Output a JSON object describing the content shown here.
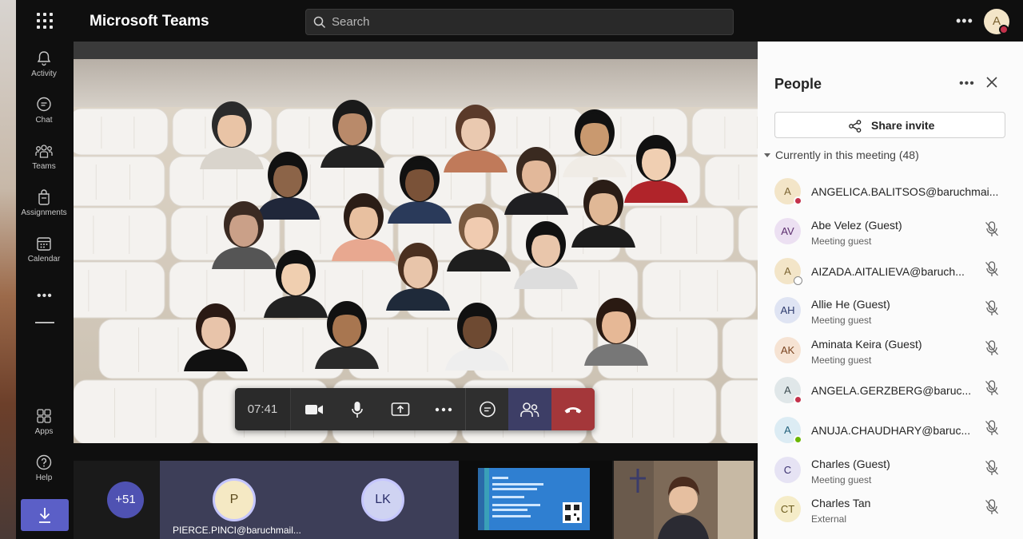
{
  "app": {
    "title": "Microsoft Teams"
  },
  "search": {
    "placeholder": "Search"
  },
  "user": {
    "initial": "A"
  },
  "rail": {
    "items": [
      {
        "label": "Activity",
        "icon": "bell-icon"
      },
      {
        "label": "Chat",
        "icon": "chat-icon"
      },
      {
        "label": "Teams",
        "icon": "teams-icon"
      },
      {
        "label": "Assignments",
        "icon": "assignments-icon"
      },
      {
        "label": "Calendar",
        "icon": "calendar-icon"
      },
      {
        "label": "Apps",
        "icon": "apps-icon"
      },
      {
        "label": "Help",
        "icon": "help-icon"
      }
    ]
  },
  "controls": {
    "timer": "07:41"
  },
  "strip": {
    "more_count": "+51",
    "tile_initials": [
      "P",
      "LK"
    ],
    "tile_name": "PIERCE.PINCI@baruchmail..."
  },
  "panel": {
    "title": "People",
    "share_invite": "Share invite",
    "section_label": "Currently in this meeting",
    "section_count": "(48)",
    "participants": [
      {
        "initials": "A",
        "name": "ANGELICA.BALITSOS@baruchmai...",
        "subtitle": "",
        "status": "busy",
        "avatar_bg": "#f3e5c8",
        "avatar_fg": "#7a6230"
      },
      {
        "initials": "AV",
        "name": "Abe Velez (Guest)",
        "subtitle": "Meeting guest",
        "status": "",
        "avatar_bg": "#ece0f2",
        "avatar_fg": "#5c2e6e"
      },
      {
        "initials": "A",
        "name": "AIZADA.AITALIEVA@baruch...",
        "subtitle": "",
        "status": "offline",
        "avatar_bg": "#f3e5c8",
        "avatar_fg": "#7a6230"
      },
      {
        "initials": "AH",
        "name": "Allie He (Guest)",
        "subtitle": "Meeting guest",
        "status": "",
        "avatar_bg": "#dfe4f3",
        "avatar_fg": "#2e3b6e"
      },
      {
        "initials": "AK",
        "name": "Aminata Keira (Guest)",
        "subtitle": "Meeting guest",
        "status": "",
        "avatar_bg": "#f6e3d3",
        "avatar_fg": "#7a4420"
      },
      {
        "initials": "A",
        "name": "ANGELA.GERZBERG@baruc...",
        "subtitle": "",
        "status": "busy",
        "avatar_bg": "#e0e7e9",
        "avatar_fg": "#3b4b50"
      },
      {
        "initials": "A",
        "name": "ANUJA.CHAUDHARY@baruc...",
        "subtitle": "",
        "status": "available",
        "avatar_bg": "#dcecf4",
        "avatar_fg": "#1f5f7a"
      },
      {
        "initials": "C",
        "name": "Charles (Guest)",
        "subtitle": "Meeting guest",
        "status": "",
        "avatar_bg": "#e6e3f4",
        "avatar_fg": "#3a3170"
      },
      {
        "initials": "CT",
        "name": "Charles Tan",
        "subtitle": "External",
        "status": "",
        "avatar_bg": "#f5ecc8",
        "avatar_fg": "#6a5a1c"
      }
    ]
  },
  "colors": {
    "accent": "#5b5fc7",
    "hangup": "#a4373a",
    "busy": "#c4314b",
    "available": "#6bb700"
  }
}
